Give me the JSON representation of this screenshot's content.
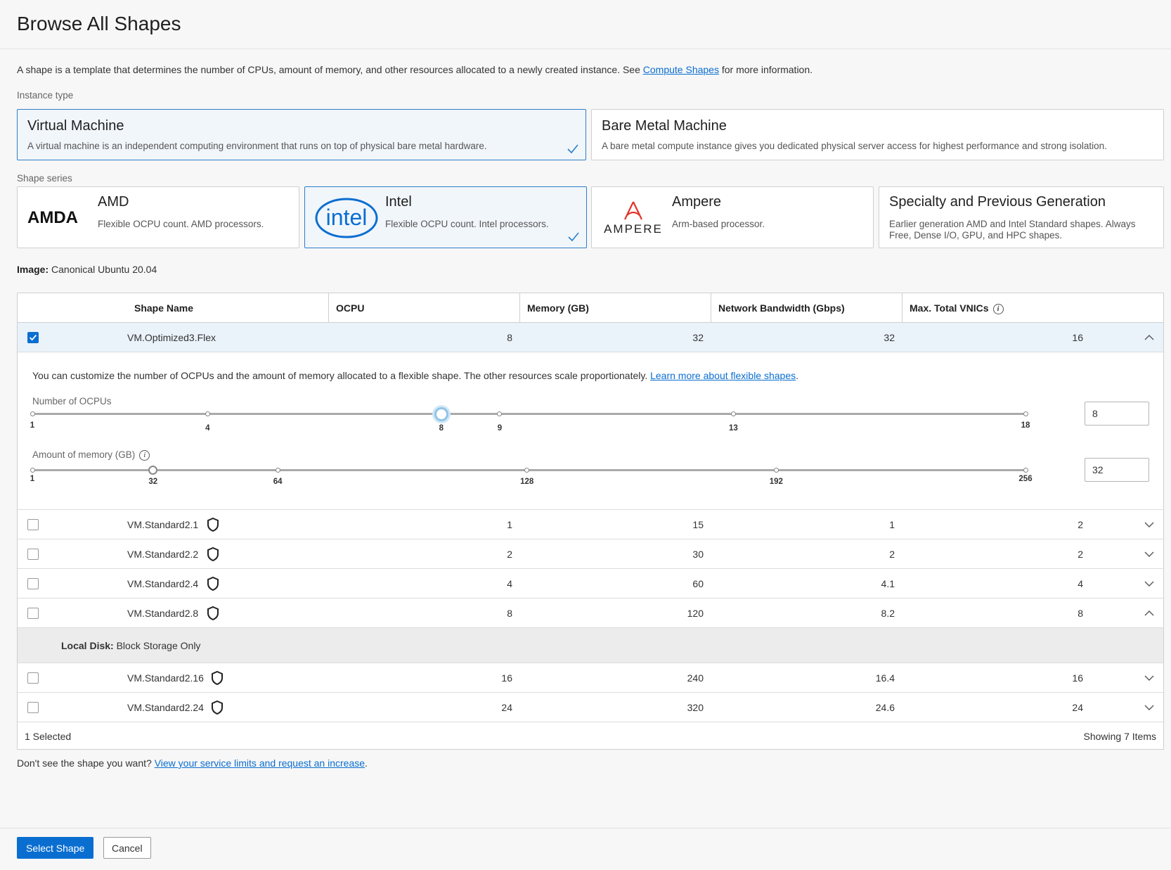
{
  "header": {
    "title": "Browse All Shapes"
  },
  "intro": {
    "text_before": "A shape is a template that determines the number of CPUs, amount of memory, and other resources allocated to a newly created instance. See ",
    "link": "Compute Shapes",
    "text_after": " for more information."
  },
  "instance_type": {
    "label": "Instance type",
    "options": [
      {
        "title": "Virtual Machine",
        "desc": "A virtual machine is an independent computing environment that runs on top of physical bare metal hardware.",
        "selected": true
      },
      {
        "title": "Bare Metal Machine",
        "desc": "A bare metal compute instance gives you dedicated physical server access for highest performance and strong isolation.",
        "selected": false
      }
    ]
  },
  "shape_series": {
    "label": "Shape series",
    "options": [
      {
        "title": "AMD",
        "desc": "Flexible OCPU count. AMD processors.",
        "logo": "AMDA",
        "selected": false
      },
      {
        "title": "Intel",
        "desc": "Flexible OCPU count. Intel processors.",
        "logo": "intel",
        "selected": true
      },
      {
        "title": "Ampere",
        "desc": "Arm-based processor.",
        "logo": "AMPERE",
        "selected": false
      },
      {
        "title": "Specialty and Previous Generation",
        "desc": "Earlier generation AMD and Intel Standard shapes. Always Free, Dense I/O, GPU, and HPC shapes.",
        "selected": false
      }
    ]
  },
  "image": {
    "label": "Image:",
    "value": "Canonical Ubuntu 20.04"
  },
  "table": {
    "columns": [
      "Shape Name",
      "OCPU",
      "Memory (GB)",
      "Network Bandwidth (Gbps)",
      "Max. Total VNICs"
    ],
    "rows": [
      {
        "name": "VM.Optimized3.Flex",
        "ocpu": "8",
        "memory": "32",
        "bandwidth": "32",
        "vnics": "16",
        "checked": true,
        "expanded": true
      },
      {
        "name": "VM.Standard2.1",
        "ocpu": "1",
        "memory": "15",
        "bandwidth": "1",
        "vnics": "2"
      },
      {
        "name": "VM.Standard2.2",
        "ocpu": "2",
        "memory": "30",
        "bandwidth": "2",
        "vnics": "2"
      },
      {
        "name": "VM.Standard2.4",
        "ocpu": "4",
        "memory": "60",
        "bandwidth": "4.1",
        "vnics": "4"
      },
      {
        "name": "VM.Standard2.8",
        "ocpu": "8",
        "memory": "120",
        "bandwidth": "8.2",
        "vnics": "8",
        "expanded": true
      },
      {
        "name": "VM.Standard2.16",
        "ocpu": "16",
        "memory": "240",
        "bandwidth": "16.4",
        "vnics": "16"
      },
      {
        "name": "VM.Standard2.24",
        "ocpu": "24",
        "memory": "320",
        "bandwidth": "24.6",
        "vnics": "24"
      }
    ],
    "flex": {
      "text_before": "You can customize the number of OCPUs and the amount of memory allocated to a flexible shape. The other resources scale proportionately. ",
      "link": "Learn more about flexible shapes",
      "text_after": ".",
      "ocpu_label": "Number of OCPUs",
      "ocpu_ticks": [
        "1",
        "4",
        "8",
        "9",
        "13",
        "18"
      ],
      "ocpu_min": 1,
      "ocpu_max": 18,
      "ocpu_value": "8",
      "memory_label": "Amount of memory (GB)",
      "memory_ticks": [
        "1",
        "32",
        "64",
        "128",
        "192",
        "256"
      ],
      "memory_min": 1,
      "memory_max": 256,
      "memory_value": "32"
    },
    "local_disk": {
      "label": "Local Disk:",
      "value": "Block Storage Only"
    },
    "footer": {
      "selected": "1 Selected",
      "showing": "Showing 7 Items"
    }
  },
  "below": {
    "text": "Don't see the shape you want? ",
    "link": "View your service limits and request an increase",
    "text_after": "."
  },
  "buttons": {
    "select": "Select Shape",
    "cancel": "Cancel"
  },
  "colors": {
    "accent": "#0a6ed1",
    "selected_bg": "#f1f6fb",
    "selected_border": "#2d7ec9"
  }
}
